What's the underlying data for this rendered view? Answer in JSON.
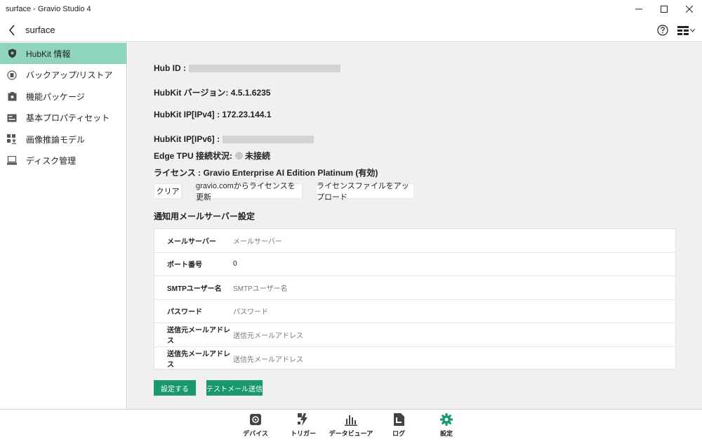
{
  "window": {
    "title": "surface - Gravio Studio 4",
    "minimize": "—",
    "maximize": "☐",
    "close": "✕"
  },
  "nav": {
    "title": "surface"
  },
  "sidebar": {
    "items": [
      {
        "label": "HubKit 情報",
        "icon": "shield-icon",
        "active": true
      },
      {
        "label": "バックアップ/リストア",
        "icon": "backup-icon",
        "active": false
      },
      {
        "label": "機能パッケージ",
        "icon": "package-icon",
        "active": false
      },
      {
        "label": "基本プロパティセット",
        "icon": "property-icon",
        "active": false
      },
      {
        "label": "画像推論モデル",
        "icon": "model-download-icon",
        "active": false
      },
      {
        "label": "ディスク管理",
        "icon": "disk-icon",
        "active": false
      }
    ]
  },
  "info": {
    "hub_id_label": "Hub ID :",
    "version_label": "HubKit バージョン:",
    "version_value": "4.5.1.6235",
    "ipv4_label": "HubKit IP[IPv4] :",
    "ipv4_value": "172.23.144.1",
    "ipv6_label": "HubKit IP[IPv6] :",
    "tpu_label": "Edge TPU 接続状況:",
    "tpu_status": "未接続",
    "license_label": "ライセンス :",
    "license_value": "Gravio Enterprise AI Edition Platinum (有効)"
  },
  "license_buttons": {
    "clear": "クリア",
    "update": "gravio.comからライセンスを更新",
    "upload": "ライセンスファイルをアップロード"
  },
  "mail": {
    "section_title": "通知用メールサーバー設定",
    "rows": [
      {
        "label": "メールサーバー",
        "value": "メールサーバー",
        "placeholder": true
      },
      {
        "label": "ポート番号",
        "value": "0",
        "placeholder": false
      },
      {
        "label": "SMTPユーザー名",
        "value": "SMTPユーザー名",
        "placeholder": true
      },
      {
        "label": "パスワード",
        "value": "パスワード",
        "placeholder": true
      },
      {
        "label": "送信元メールアドレス",
        "value": "送信元メールアドレス",
        "placeholder": true
      },
      {
        "label": "送信先メールアドレス",
        "value": "送信先メールアドレス",
        "placeholder": true
      }
    ],
    "save_label": "設定する",
    "test_label": "テストメール送信"
  },
  "bottom_nav": {
    "items": [
      {
        "label": "デバイス",
        "icon": "device-icon"
      },
      {
        "label": "トリガー",
        "icon": "trigger-icon"
      },
      {
        "label": "データビューア",
        "icon": "data-viewer-icon"
      },
      {
        "label": "ログ",
        "icon": "log-icon"
      },
      {
        "label": "設定",
        "icon": "gear-icon",
        "active": true
      }
    ]
  },
  "colors": {
    "accent": "#17996c",
    "sidebar_active": "#8fd4be",
    "main_bg": "#f0f0f0"
  }
}
